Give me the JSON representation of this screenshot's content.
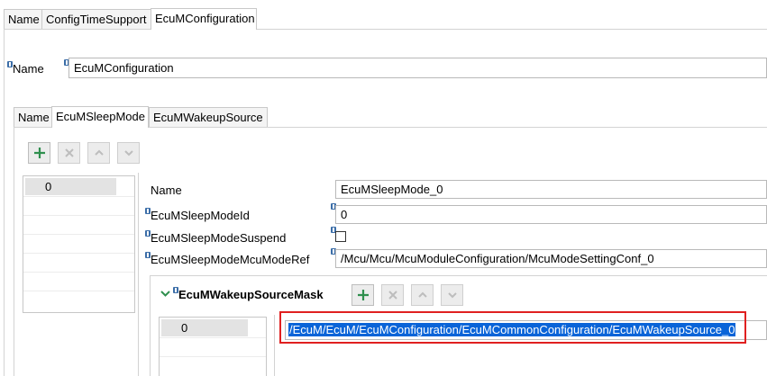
{
  "top_tabs": [
    "Name",
    "ConfigTimeSupport",
    "EcuMConfiguration"
  ],
  "name_field": {
    "label": "Name",
    "value": "EcuMConfiguration"
  },
  "inner_tabs": [
    "Name",
    "EcuMSleepMode",
    "EcuMWakeupSource"
  ],
  "toolbar": {
    "add_icon": "plus-icon",
    "remove_icon": "x-icon",
    "up_icon": "chevron-up-icon",
    "down_icon": "chevron-down-icon"
  },
  "sleep_mode_list": [
    "0"
  ],
  "sleep_mode": {
    "name_label": "Name",
    "name_value": "EcuMSleepMode_0",
    "id_label": "EcuMSleepModeId",
    "id_value": "0",
    "suspend_label": "EcuMSleepModeSuspend",
    "suspend_checked": false,
    "mcu_ref_label": "EcuMSleepModeMcuModeRef",
    "mcu_ref_value": "/Mcu/Mcu/McuModuleConfiguration/McuModeSettingConf_0"
  },
  "wakeup_mask": {
    "title": "EcuMWakeupSourceMask",
    "list": [
      "0"
    ],
    "selected_value": "/EcuM/EcuM/EcuMConfiguration/EcuMCommonConfiguration/EcuMWakeupSource_0"
  },
  "colors": {
    "highlight": "#0a64d8",
    "annotation_border": "#e02020",
    "accent_green": "#2f8f4e"
  }
}
